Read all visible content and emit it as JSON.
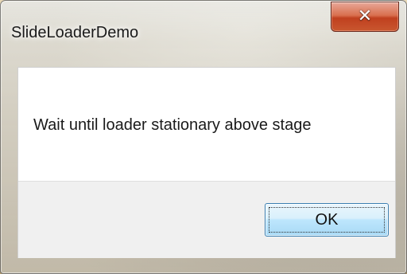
{
  "window": {
    "title": "SlideLoaderDemo",
    "close_icon": "close-icon",
    "close_glyph": "✕"
  },
  "dialog": {
    "message": "Wait until loader stationary above stage",
    "ok_label": "OK"
  },
  "colors": {
    "close_button": "#c9572f",
    "ok_button_border": "#3c7fb1",
    "button_strip": "#f0f0f0"
  }
}
